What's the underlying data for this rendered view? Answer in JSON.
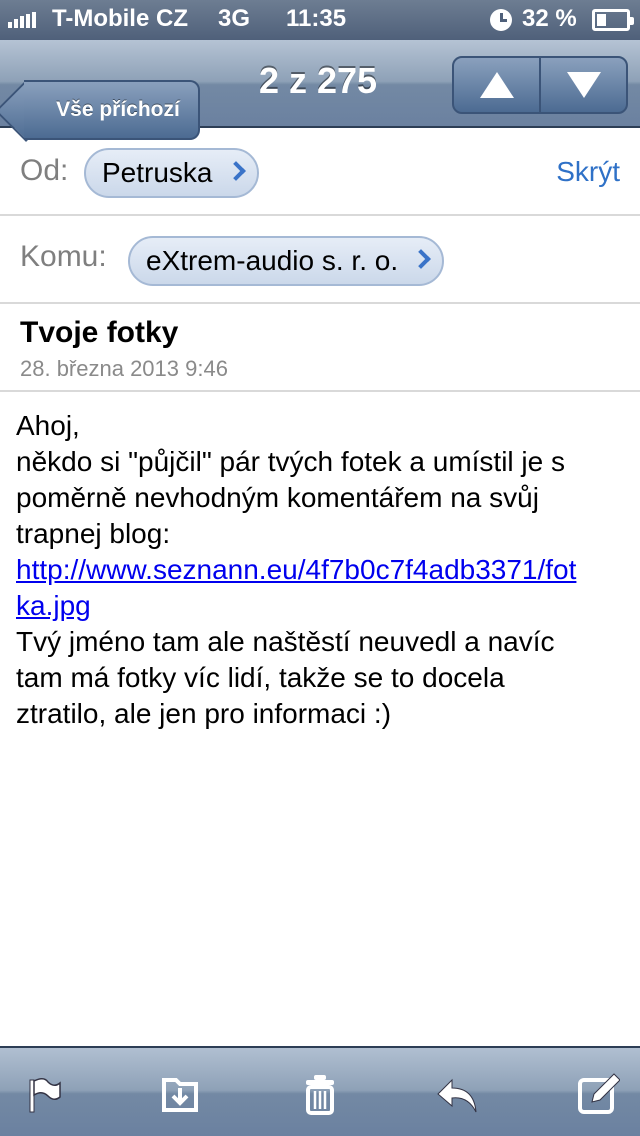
{
  "status_bar": {
    "carrier": "T-Mobile CZ",
    "network": "3G",
    "time": "11:35",
    "battery_percent": "32 %",
    "battery_level": 0.32,
    "icons": [
      "signal-icon",
      "alarm-icon",
      "battery-icon"
    ]
  },
  "nav": {
    "back_label": "Vše příchozí",
    "title": "2 z 275",
    "up_icon": "arrow-up-icon",
    "down_icon": "arrow-down-icon"
  },
  "header": {
    "from_label": "Od:",
    "from_name": "Petruska",
    "hide_label": "Skrýt",
    "to_label": "Komu:",
    "to_name": "eXtrem-audio s. r. o.",
    "subject": "Tvoje fotky",
    "date": "28. března 2013 9:46"
  },
  "body": {
    "lines_before_link": [
      "Ahoj,",
      "někdo si \"půjčil\" pár tvých fotek a umístil je s",
      "poměrně nevhodným komentářem na svůj",
      "trapnej blog:"
    ],
    "link_line_1": "http://www.seznann.eu/4f7b0c7f4adb3371/fot",
    "link_line_2": "ka.jpg",
    "lines_after_link": [
      "Tvý jméno tam ale naštěstí neuvedl a navíc",
      "tam má fotky víc lidí, takže se to docela",
      "ztratilo, ale jen pro informaci :)"
    ]
  },
  "toolbar": {
    "icons": [
      "flag-icon",
      "move-folder-icon",
      "trash-icon",
      "reply-icon",
      "compose-icon"
    ]
  },
  "colors": {
    "link": "#0000ee",
    "accent_blue": "#2f71c7",
    "nav_bar": "#7389a4"
  }
}
